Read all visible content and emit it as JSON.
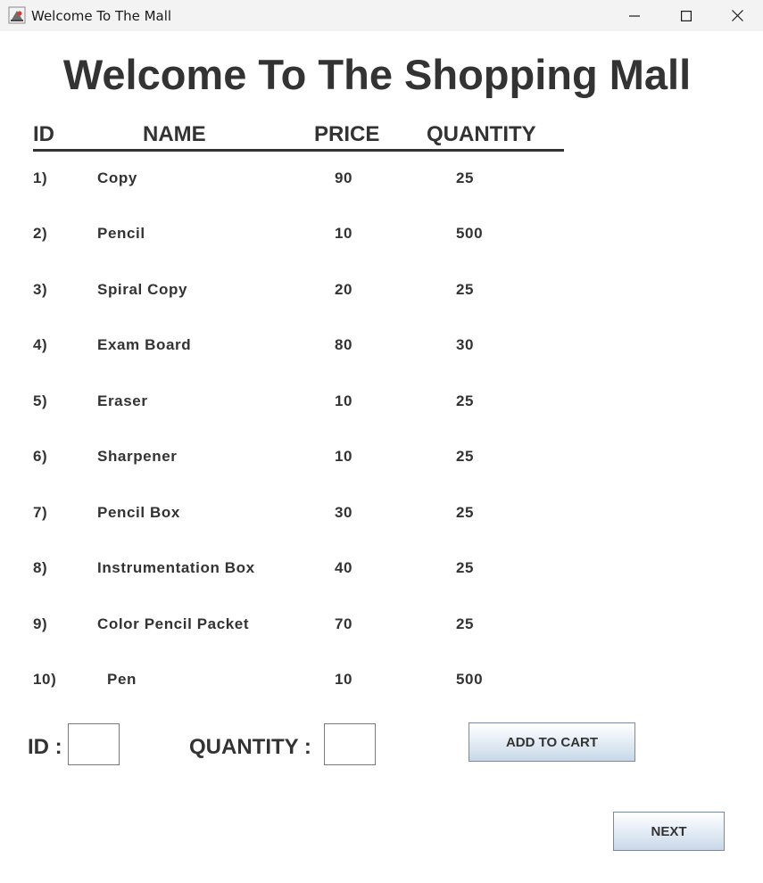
{
  "window": {
    "title": "Welcome To The Mall",
    "icons": {
      "app": "java-app-icon",
      "minimize": "minimize-icon",
      "maximize": "maximize-icon",
      "close": "close-icon"
    }
  },
  "heading": "Welcome To The Shopping Mall",
  "table": {
    "headers": {
      "id": "ID",
      "name": "NAME",
      "price": "PRICE",
      "quantity": "QUANTITY"
    },
    "rows": [
      {
        "id": "1)",
        "name": "Copy",
        "price": "90",
        "quantity": "25"
      },
      {
        "id": "2)",
        "name": "Pencil",
        "price": "10",
        "quantity": "500"
      },
      {
        "id": "3)",
        "name": "Spiral Copy",
        "price": "20",
        "quantity": "25"
      },
      {
        "id": "4)",
        "name": "Exam Board",
        "price": "80",
        "quantity": "30"
      },
      {
        "id": "5)",
        "name": "Eraser",
        "price": "10",
        "quantity": "25"
      },
      {
        "id": "6)",
        "name": "Sharpener",
        "price": "10",
        "quantity": "25"
      },
      {
        "id": "7)",
        "name": "Pencil Box",
        "price": "30",
        "quantity": "25"
      },
      {
        "id": "8)",
        "name": "Instrumentation Box",
        "price": "40",
        "quantity": "25"
      },
      {
        "id": "9)",
        "name": "Color Pencil Packet",
        "price": "70",
        "quantity": "25"
      },
      {
        "id": "10)",
        "name": "Pen",
        "price": "10",
        "quantity": "500"
      }
    ]
  },
  "form": {
    "id_label": "ID :",
    "id_value": "",
    "quantity_label": "QUANTITY :",
    "quantity_value": "",
    "add_to_cart_label": "ADD TO CART",
    "next_label": "NEXT"
  }
}
